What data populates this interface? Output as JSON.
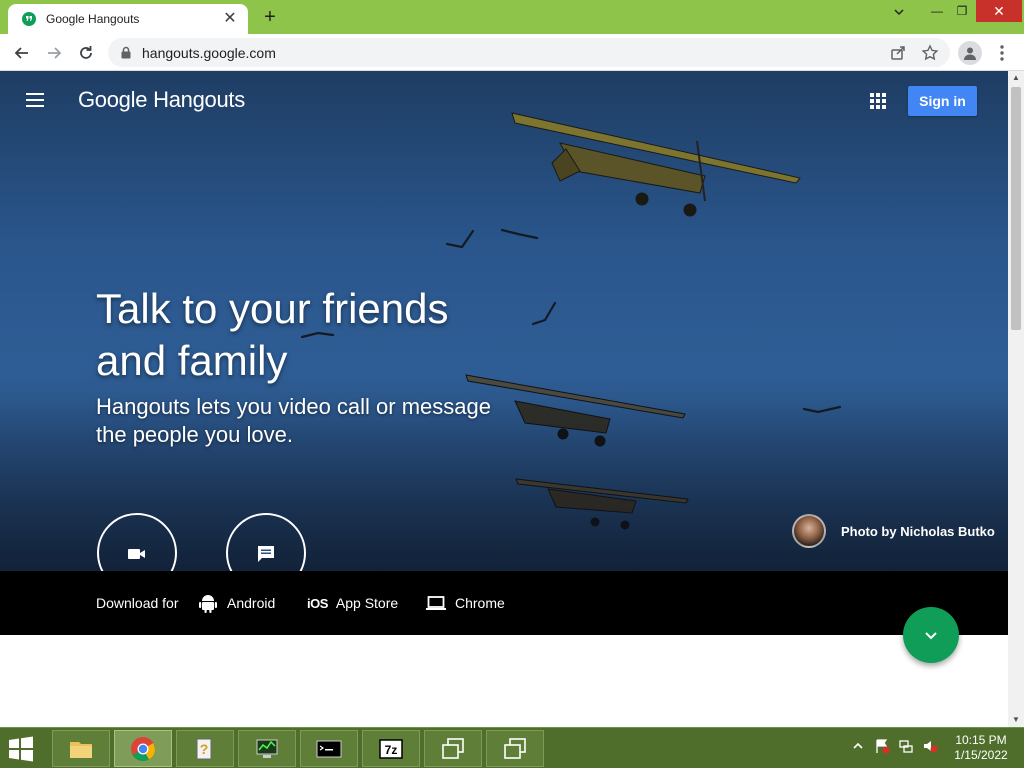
{
  "browser": {
    "tab_title": "Google Hangouts",
    "url": "hangouts.google.com",
    "new_tab_symbol": "+",
    "tab_close_symbol": "✕",
    "minimize_symbol": "—",
    "maximize_symbol": "❐",
    "close_symbol": "✕",
    "dropdown_symbol": "⌄"
  },
  "header": {
    "brand_google": "Google",
    "brand_product": "Hangouts",
    "signin_label": "Sign in"
  },
  "hero": {
    "headline_line1": "Talk to your friends",
    "headline_line2": "and family",
    "subline_line1": "Hangouts lets you video call or message",
    "subline_line2": "the people you love.",
    "photo_credit": "Photo by Nicholas Butko"
  },
  "download": {
    "label": "Download for",
    "android_label": "Android",
    "ios_glyph": "iOS",
    "appstore_label": "App Store",
    "chrome_label": "Chrome"
  },
  "taskbar": {
    "time": "10:15 PM",
    "date": "1/15/2022",
    "apps": [
      "file-explorer",
      "chrome",
      "help",
      "system-monitor",
      "command-prompt",
      "7-zip",
      "window-switcher",
      "window-switcher-2"
    ]
  },
  "colors": {
    "titlebar": "#8dc449",
    "signin_button": "#4285f4",
    "fab": "#0f9d58",
    "download_bar": "#000000",
    "taskbar": "#4f6e2b"
  }
}
